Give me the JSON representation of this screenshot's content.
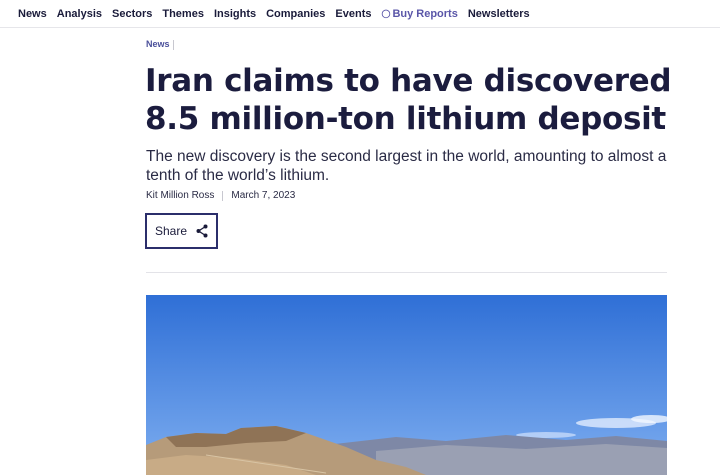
{
  "nav": {
    "items": [
      {
        "label": "News"
      },
      {
        "label": "Analysis"
      },
      {
        "label": "Sectors"
      },
      {
        "label": "Themes"
      },
      {
        "label": "Insights"
      },
      {
        "label": "Companies"
      },
      {
        "label": "Events"
      },
      {
        "label": "Buy Reports",
        "icon": "tag-icon"
      },
      {
        "label": "Newsletters"
      }
    ],
    "accent_color": "#5a56a8"
  },
  "article": {
    "category": "News",
    "headline": "Iran claims to have discovered 8.5 million-ton lithium deposit",
    "subtitle": "The new discovery is the second largest in the world, amounting to almost a tenth of the world’s lithium.",
    "author": "Kit Million Ross",
    "date": "March 7, 2023",
    "share_label": "Share",
    "share_icon": "share-icon"
  },
  "colors": {
    "text": "#1a1b3a",
    "button_border": "#2b2e6b",
    "sky_top": "#2f6fd6",
    "sky_bottom": "#7eaef0"
  }
}
